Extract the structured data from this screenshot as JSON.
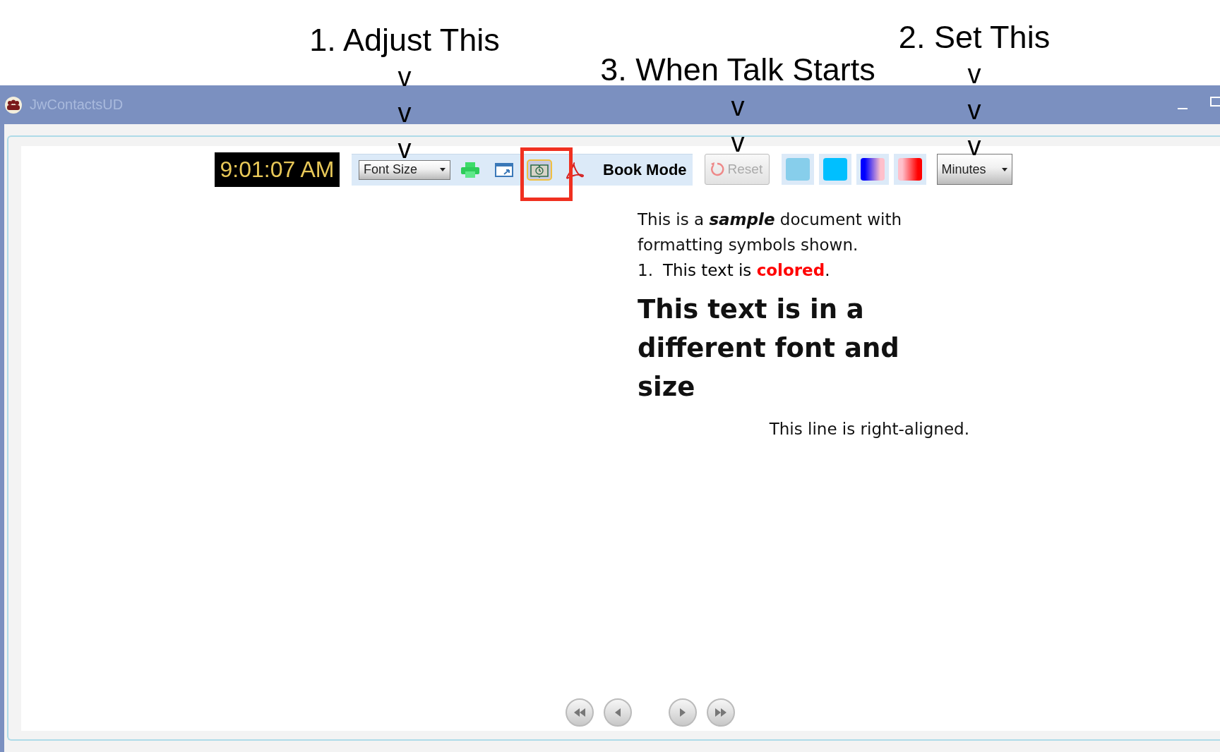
{
  "annotations": [
    {
      "label": "1. Adjust This",
      "marks": [
        "v",
        "v",
        "v"
      ]
    },
    {
      "label": "3. When Talk Starts",
      "marks": [
        "v",
        "v"
      ]
    },
    {
      "label": "2. Set This",
      "marks": [
        "v",
        "v",
        "v"
      ]
    }
  ],
  "window": {
    "title": "JwContactsUD"
  },
  "toolbar": {
    "clock": "9:01:07 AM",
    "font_size": {
      "label": "Font Size"
    },
    "icons": [
      {
        "kind": "print",
        "selected": false
      },
      {
        "kind": "window",
        "selected": false
      },
      {
        "kind": "book",
        "selected": true
      },
      {
        "kind": "pdf",
        "selected": false
      }
    ],
    "book_mode": "Book Mode",
    "reset": {
      "label": "Reset",
      "disabled": true
    },
    "swatches": [
      {
        "stops": [
          {
            "color": "#87ceeb"
          }
        ]
      },
      {
        "stops": [
          {
            "color": "#00bfff"
          }
        ]
      },
      {
        "stops": [
          {
            "color": "#0000ff"
          },
          {
            "color": "#ffc0cb"
          }
        ]
      },
      {
        "stops": [
          {
            "color": "#ffc0cb"
          },
          {
            "color": "#ff0000"
          }
        ]
      }
    ],
    "minutes": {
      "label": "Minutes"
    }
  },
  "document": {
    "intro": "This is a **sample** document with formatting symbols shown.",
    "list_item": {
      "marker": "1.",
      "parts": [
        {
          "text": "This text is ",
          "color": "#000000"
        },
        {
          "text": "colored",
          "color": "#ff0000"
        },
        {
          "text": ".",
          "color": "#000000"
        }
      ]
    },
    "heading": "This text is in a different font and size",
    "right_line": "This line is right-aligned."
  },
  "navigation": [
    {
      "kind": "first"
    },
    {
      "kind": "prev"
    },
    {
      "kind": "next"
    },
    {
      "kind": "last"
    }
  ]
}
